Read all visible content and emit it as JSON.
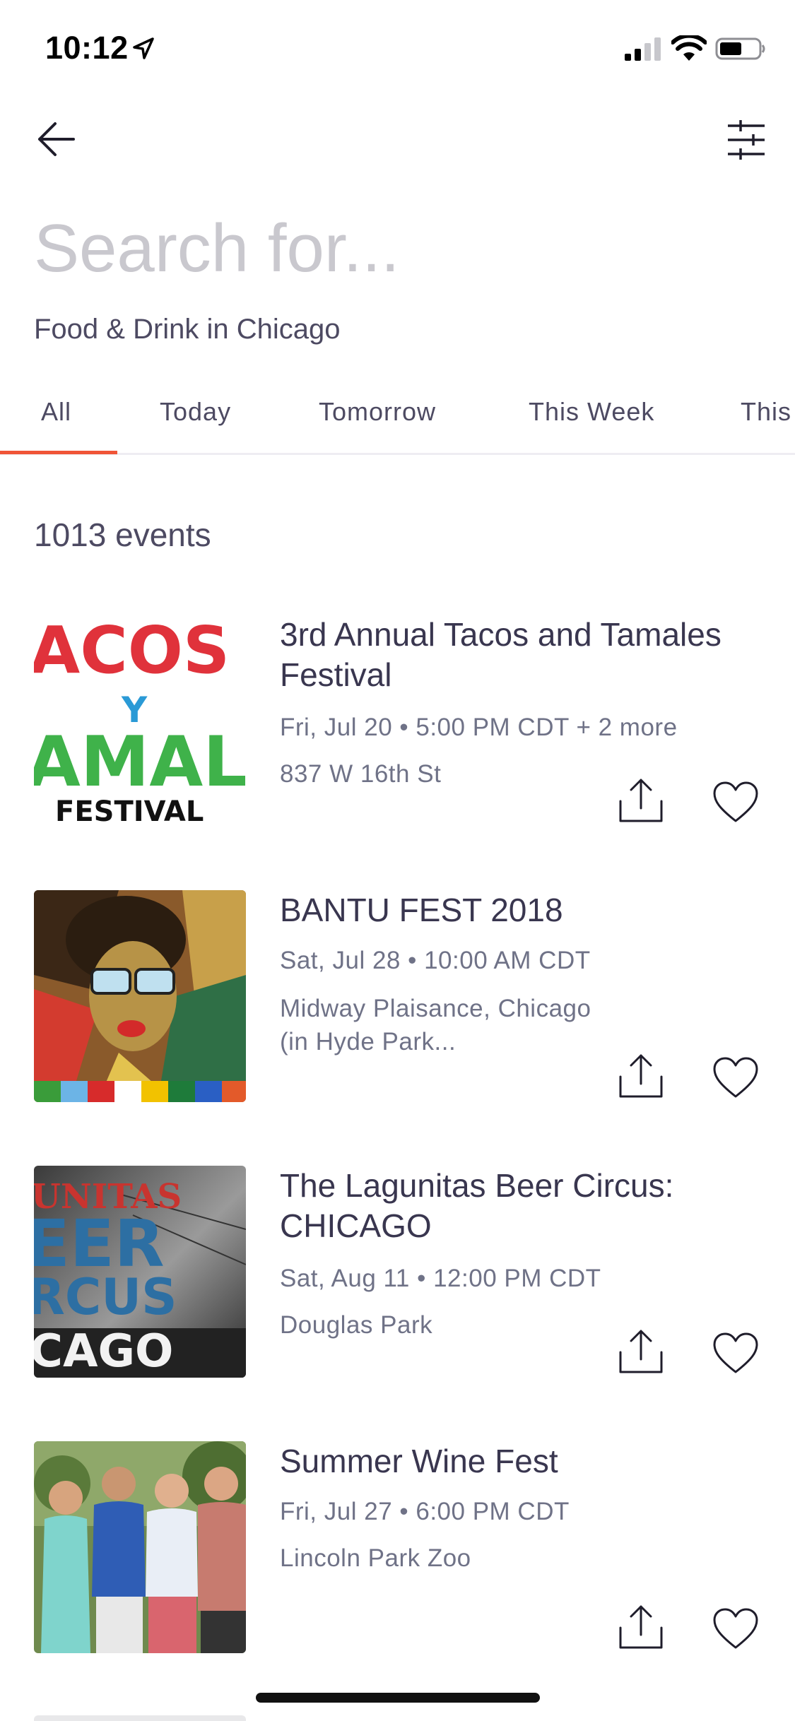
{
  "status_bar": {
    "time": "10:12"
  },
  "search": {
    "placeholder": "Search for..."
  },
  "location": "Food & Drink in Chicago",
  "tabs": [
    {
      "label": "All",
      "selected": true
    },
    {
      "label": "Today",
      "selected": false
    },
    {
      "label": "Tomorrow",
      "selected": false
    },
    {
      "label": "This Week",
      "selected": false
    },
    {
      "label": "This",
      "selected": false
    }
  ],
  "accent_color": "#f05537",
  "event_count": "1013 events",
  "events": [
    {
      "title": "3rd Annual Tacos and Tamales Festival",
      "date": "Fri, Jul 20 • 5:00 PM CDT + 2 more",
      "venue": "837 W 16th St",
      "thumb_text": {
        "line1": "ACOS",
        "line2": "Y",
        "line3": "AMAL",
        "line4": "FESTIVAL"
      }
    },
    {
      "title": "BANTU FEST 2018",
      "date": "Sat, Jul 28 • 10:00 AM CDT",
      "venue": "Midway Plaisance, Chicago (in Hyde Park..."
    },
    {
      "title": "The Lagunitas Beer Circus: CHICAGO",
      "date": "Sat, Aug 11 • 12:00 PM CDT",
      "venue": "Douglas Park",
      "thumb_text": {
        "line1": "UNITAS",
        "line2": "EER",
        "line3": "RCUS",
        "line4": "CAGO"
      }
    },
    {
      "title": "Summer Wine Fest",
      "date": "Fri, Jul 27 • 6:00 PM CDT",
      "venue": "Lincoln Park Zoo"
    }
  ]
}
